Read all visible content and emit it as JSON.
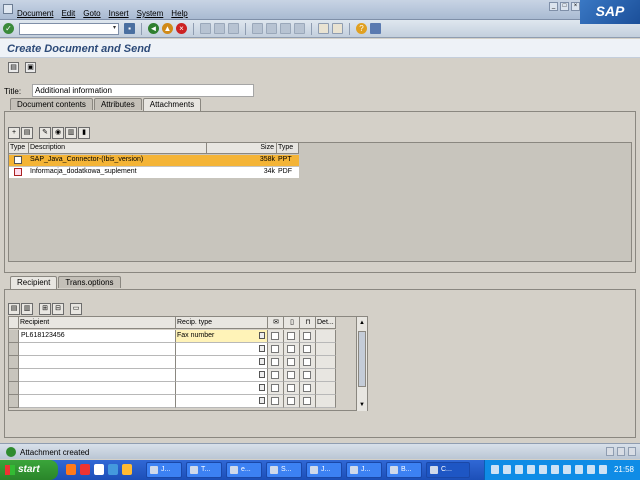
{
  "menubar": {
    "items": [
      "Document",
      "Edit",
      "Goto",
      "Insert",
      "System",
      "Help"
    ],
    "logo": "SAP"
  },
  "toolbar": {
    "command_field_value": ""
  },
  "page": {
    "title": "Create Document and Send"
  },
  "doc": {
    "title_label": "Title:",
    "title_value": "Additional information"
  },
  "top_tabs": [
    {
      "label": "Document contents",
      "active": false
    },
    {
      "label": "Attributes",
      "active": false
    },
    {
      "label": "Attachments",
      "active": true
    }
  ],
  "attachments": {
    "columns": {
      "type": "Type",
      "description": "Description",
      "size": "Size",
      "type2": "Type"
    },
    "rows": [
      {
        "description": "SAP_Java_Connector-(Ibis_version)",
        "size": "358k",
        "type": "PPT",
        "selected": true
      },
      {
        "description": "Informacja_dodatkowa_suplement",
        "size": "34k",
        "type": "PDF",
        "selected": false
      }
    ]
  },
  "bottom_tabs": [
    {
      "label": "Recipient",
      "active": true
    },
    {
      "label": "Trans.options",
      "active": false
    }
  ],
  "recipients": {
    "columns": {
      "recipient": "Recipient",
      "type": "Recip. type",
      "det": "Det..."
    },
    "rows": [
      {
        "recipient": "PL618123456",
        "type": "Fax number"
      },
      {
        "recipient": "",
        "type": ""
      },
      {
        "recipient": "",
        "type": ""
      },
      {
        "recipient": "",
        "type": ""
      },
      {
        "recipient": "",
        "type": ""
      },
      {
        "recipient": "",
        "type": ""
      }
    ]
  },
  "status": {
    "message": "Attachment created"
  },
  "taskbar": {
    "start_label": "start",
    "tasks": [
      "J...",
      "T...",
      "e...",
      "S...",
      "J...",
      "J...",
      "B...",
      "C..."
    ],
    "clock": "21:58"
  },
  "colors": {
    "selected_row": "#f4b436",
    "title_text": "#2c4a78",
    "taskbar": "#1c4fb8",
    "start_button": "#2a852a"
  }
}
